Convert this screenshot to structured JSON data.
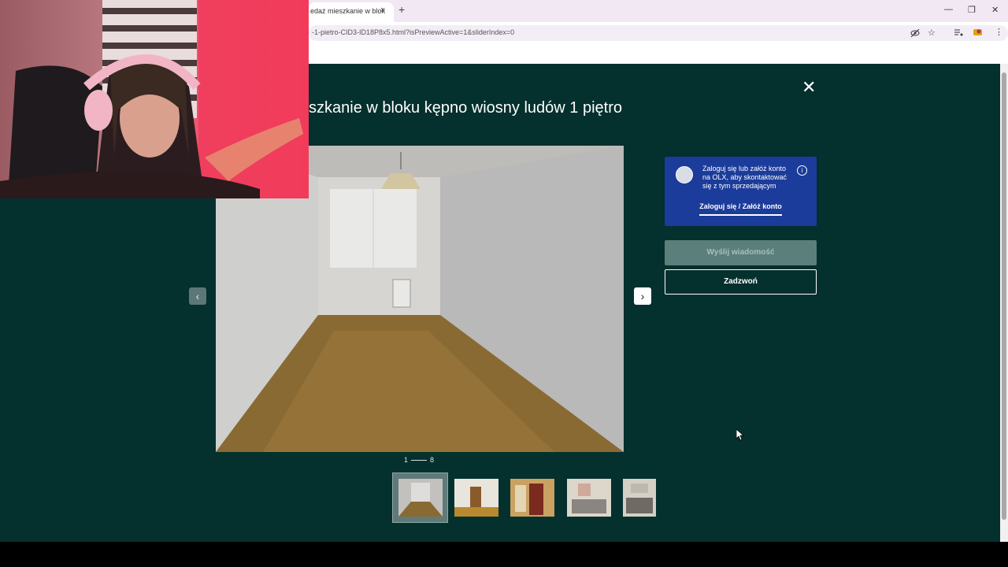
{
  "browser": {
    "tab_title": "edaż mieszkanie w blok",
    "tab_close": "×",
    "new_tab": "+",
    "url": "-1-pietro-CID3-ID18P8x5.html?isPreviewActive=1&sliderIndex=0",
    "window_controls": [
      "—",
      "❐",
      "✕"
    ]
  },
  "listing": {
    "title": "szkanie w bloku kępno wiosny ludów 1 piętro",
    "close_label": "✕",
    "counter_current": "1",
    "counter_total": "8",
    "prev_arrow": "‹",
    "next_arrow": "›"
  },
  "contact": {
    "login_message": "Zaloguj się lub załóż konto na OLX, aby skontaktować się z tym sprzedającym",
    "info_icon": "i",
    "login_link": "Zaloguj się / Załóż konto",
    "send_message": "Wyślij wiadomość",
    "call": "Zadzwoń"
  },
  "colors": {
    "page_bg": "#04302e",
    "login_box": "#1b3c9a",
    "disabled_button": "#5b7f7b"
  }
}
